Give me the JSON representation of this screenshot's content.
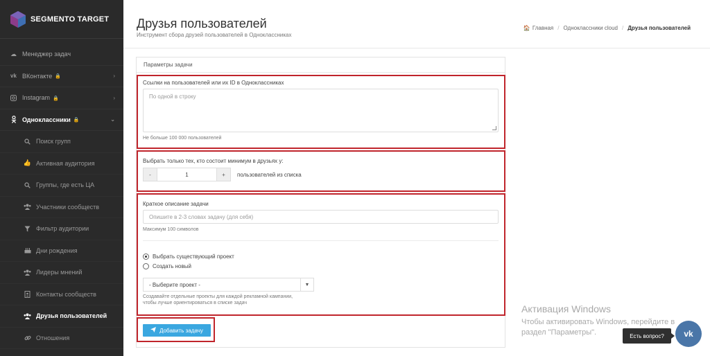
{
  "app": {
    "logo_text": "SEGMENTO TARGET"
  },
  "sidebar": {
    "items": [
      {
        "label": "Менеджер задач",
        "icon": "cloud-icon"
      },
      {
        "label": "ВКонтакте",
        "icon": "vk-icon",
        "locked": true,
        "arrow": "›"
      },
      {
        "label": "Instagram",
        "icon": "instagram-icon",
        "locked": true,
        "arrow": "›"
      },
      {
        "label": "Одноклассники",
        "icon": "odnoklassniki-icon",
        "locked": true,
        "arrow": "⌄"
      }
    ],
    "sub_items": [
      {
        "label": "Поиск групп",
        "icon": "search-icon"
      },
      {
        "label": "Активная аудитория",
        "icon": "thumbs-up-icon"
      },
      {
        "label": "Группы, где есть ЦА",
        "icon": "search-icon"
      },
      {
        "label": "Участники сообществ",
        "icon": "users-icon"
      },
      {
        "label": "Фильтр аудитории",
        "icon": "filter-icon"
      },
      {
        "label": "Дни рождения",
        "icon": "birthday-cake-icon"
      },
      {
        "label": "Лидеры мнений",
        "icon": "users-icon"
      },
      {
        "label": "Контакты сообществ",
        "icon": "address-book-icon"
      },
      {
        "label": "Друзья пользователей",
        "icon": "users-icon"
      },
      {
        "label": "Отношения",
        "icon": "link-icon"
      }
    ]
  },
  "header": {
    "title": "Друзья пользователей",
    "subtitle": "Инструмент сбора друзей пользователей в Одноклассниках",
    "breadcrumb": {
      "home": "Главная",
      "section": "Одноклассники cloud",
      "current": "Друзья пользователей"
    }
  },
  "panel": {
    "title": "Параметры задачи",
    "links": {
      "label": "Ссылки на пользователей или их ID в Одноклассниках",
      "placeholder": "По одной в строку",
      "hint": "Не больше 100 000 пользователей"
    },
    "min_friends": {
      "label": "Выбрать только тех, кто состоит минимум в друзьях у:",
      "minus": "-",
      "value": "1",
      "plus": "+",
      "suffix": "пользователей из списка"
    },
    "description": {
      "label": "Краткое описание задачи",
      "placeholder": "Опишите в 2-3 словах задачу (для себя)",
      "hint": "Максимум 100 символов"
    },
    "project": {
      "option_existing": "Выбрать существующий проект",
      "option_new": "Создать новый",
      "select_value": "- Выберите проект -",
      "hint_line1": "Создавайте отдельные проекты для каждой рекламной кампании,",
      "hint_line2": "чтобы лучше ориентироваться в списке задач"
    },
    "add_button": "Добавить задачу"
  },
  "windows": {
    "title": "Активация Windows",
    "line1": "Чтобы активировать Windows, перейдите в",
    "line2": "раздел \"Параметры\"."
  },
  "chat": {
    "bubble": "Есть вопрос?",
    "vk": "vk"
  },
  "colors": {
    "sidebar": "#2a2a2a",
    "accent": "#3aa7e0",
    "highlight": "#c0242b",
    "vk": "#4a76a8"
  }
}
